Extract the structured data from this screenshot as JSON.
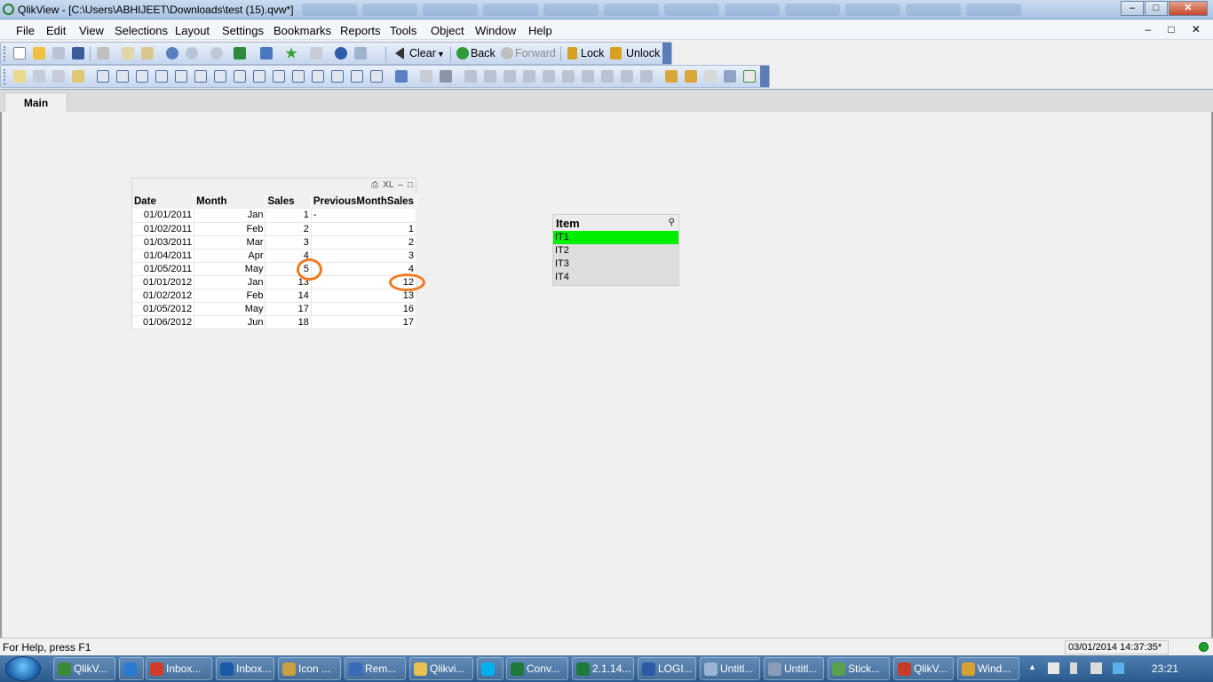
{
  "window": {
    "title": "QlikView - [C:\\Users\\ABHIJEET\\Downloads\\test (15).qvw*]",
    "min": "–",
    "max": "□",
    "close": "✕"
  },
  "menu": [
    "File",
    "Edit",
    "View",
    "Selections",
    "Layout",
    "Settings",
    "Bookmarks",
    "Reports",
    "Tools",
    "Object",
    "Window",
    "Help"
  ],
  "mdi_controls": "– □ ✕",
  "toolbar": {
    "clear": "Clear",
    "back": "Back",
    "forward": "Forward",
    "lock": "Lock",
    "unlock": "Unlock"
  },
  "tabs": [
    "Main"
  ],
  "table": {
    "caption_icons": [
      "⎙",
      "XL",
      "–",
      "□"
    ],
    "columns": [
      "Date",
      "Month",
      "Sales",
      "PreviousMonthSales"
    ],
    "rows": [
      [
        "01/01/2011",
        "Jan",
        "1",
        "-"
      ],
      [
        "01/02/2011",
        "Feb",
        "2",
        "1"
      ],
      [
        "01/03/2011",
        "Mar",
        "3",
        "2"
      ],
      [
        "01/04/2011",
        "Apr",
        "4",
        "3"
      ],
      [
        "01/05/2011",
        "May",
        "5",
        "4"
      ],
      [
        "01/01/2012",
        "Jan",
        "13",
        "12"
      ],
      [
        "01/02/2012",
        "Feb",
        "14",
        "13"
      ],
      [
        "01/05/2012",
        "May",
        "17",
        "16"
      ],
      [
        "01/06/2012",
        "Jun",
        "18",
        "17"
      ]
    ],
    "highlight_color": "#ee7b22"
  },
  "listbox": {
    "title": "Item",
    "items": [
      "IT1",
      "IT2",
      "IT3",
      "IT4"
    ],
    "selected_index": 0,
    "selected_color": "#00ee00"
  },
  "status": {
    "help": "For Help, press F1",
    "timestamp": "03/01/2014 14:37:35*"
  },
  "taskbar": {
    "items": [
      "QlikV...",
      "",
      "Inbox...",
      "Inbox...",
      "Icon ...",
      "Rem...",
      "Qlikvi...",
      "",
      "Conv...",
      "2.1.14...",
      "LOGI...",
      "Untitl...",
      "Untitl...",
      "Stick...",
      "QlikV...",
      "Wind..."
    ],
    "clock": "23:21"
  }
}
